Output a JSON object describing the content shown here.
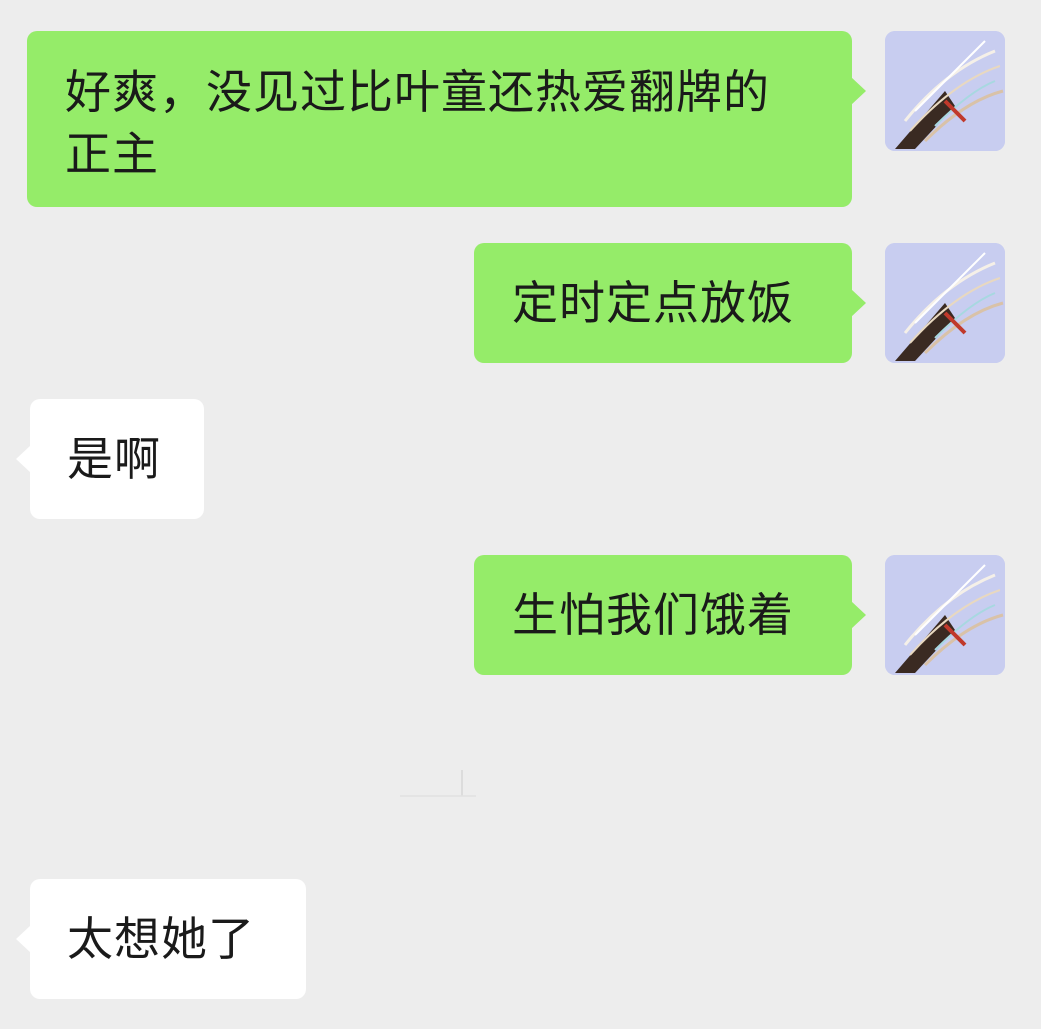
{
  "messages": [
    {
      "side": "sent",
      "text": "好爽，没见过比叶童还热爱翻牌的正主"
    },
    {
      "side": "sent",
      "text": "定时定点放饭"
    },
    {
      "side": "received",
      "text": "是啊"
    },
    {
      "side": "sent",
      "text": "生怕我们饿着"
    },
    {
      "side": "received",
      "text": "太想她了"
    }
  ],
  "avatar": {
    "icon": "user-avatar-image"
  },
  "colors": {
    "background": "#ededed",
    "sent_bubble": "#95ec69",
    "received_bubble": "#ffffff",
    "text": "#1a1a1a"
  }
}
